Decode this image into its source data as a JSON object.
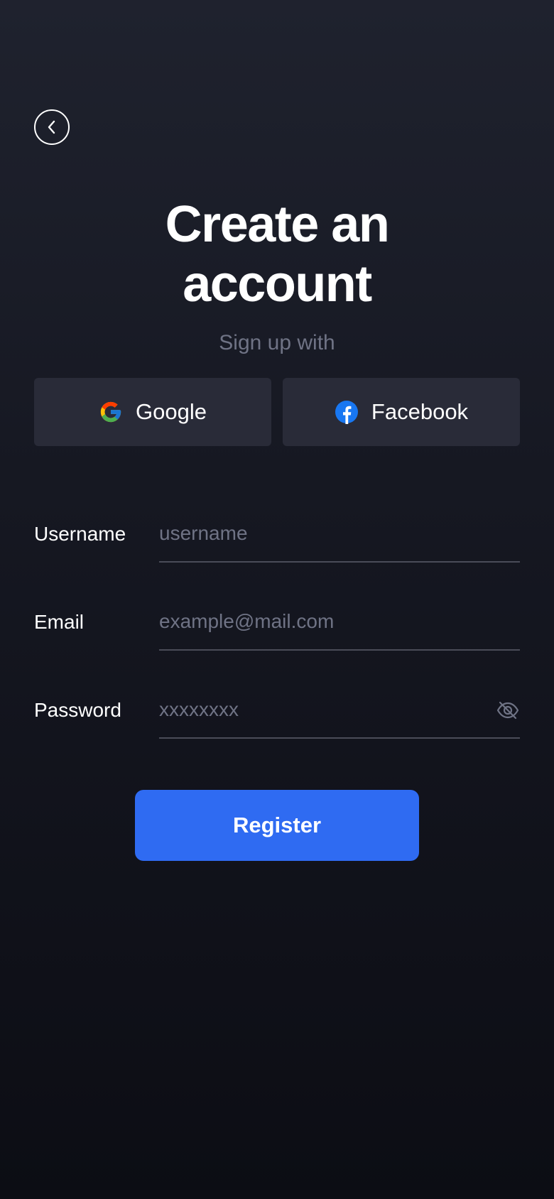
{
  "header": {
    "back_icon": "chevron-left-icon"
  },
  "title": {
    "line1": "Create an",
    "line2": "account"
  },
  "subtitle": "Sign up with",
  "social": {
    "google_label": "Google",
    "google_icon": "google-icon",
    "facebook_label": "Facebook",
    "facebook_icon": "facebook-icon"
  },
  "form": {
    "username": {
      "label": "Username",
      "placeholder": "username"
    },
    "email": {
      "label": "Email",
      "placeholder": "example@mail.com"
    },
    "password": {
      "label": "Password",
      "placeholder": "xxxxxxxx",
      "toggle_icon": "eye-off-icon"
    }
  },
  "register_label": "Register",
  "colors": {
    "background_top": "#1f222e",
    "background_bottom": "#0c0d14",
    "social_button": "#292b38",
    "accent": "#2f6bf2",
    "muted_text": "#6f7385",
    "divider": "#4a4c58"
  }
}
